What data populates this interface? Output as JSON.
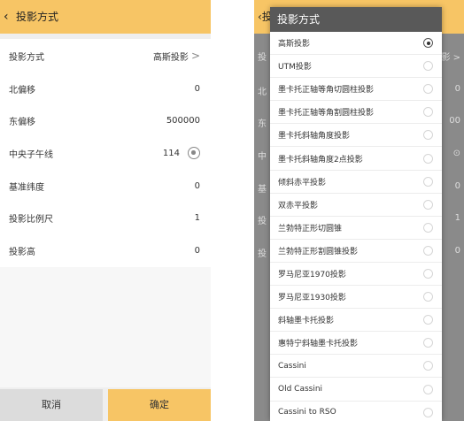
{
  "left": {
    "back_glyph": "‹",
    "title": "投影方式",
    "rows": [
      {
        "label": "投影方式",
        "value": "高斯投影",
        "chevron": ">"
      },
      {
        "label": "北偏移",
        "value": "0"
      },
      {
        "label": "东偏移",
        "value": "500000"
      },
      {
        "label": "中央子午线",
        "value": "114"
      },
      {
        "label": "基准纬度",
        "value": "0"
      },
      {
        "label": "投影比例尺",
        "value": "1"
      },
      {
        "label": "投影高",
        "value": "0"
      }
    ],
    "cancel_label": "取消",
    "ok_label": "确定"
  },
  "right": {
    "bg_header_fragment": "‹投",
    "bg_left_fragments": [
      "投",
      "北",
      "东",
      "中",
      "基",
      "投",
      "投"
    ],
    "bg_right_fragments": [
      "影 >",
      "0",
      "00",
      "⊙",
      "0",
      "1",
      "0"
    ],
    "dialog_title": "投影方式",
    "options": [
      {
        "label": "高斯投影",
        "selected": true
      },
      {
        "label": "UTM投影",
        "selected": false
      },
      {
        "label": "墨卡托正轴等角切圆柱投影",
        "selected": false
      },
      {
        "label": "墨卡托正轴等角割圆柱投影",
        "selected": false
      },
      {
        "label": "墨卡托斜轴角度投影",
        "selected": false
      },
      {
        "label": "墨卡托斜轴角度2点投影",
        "selected": false
      },
      {
        "label": "倾斜赤平投影",
        "selected": false
      },
      {
        "label": "双赤平投影",
        "selected": false
      },
      {
        "label": "兰勃特正形切圆锥",
        "selected": false
      },
      {
        "label": "兰勃特正形割圆锥投影",
        "selected": false
      },
      {
        "label": "罗马尼亚1970投影",
        "selected": false
      },
      {
        "label": "罗马尼亚1930投影",
        "selected": false
      },
      {
        "label": "斜轴墨卡托投影",
        "selected": false
      },
      {
        "label": "惠特宁斜轴墨卡托投影",
        "selected": false
      },
      {
        "label": "Cassini",
        "selected": false
      },
      {
        "label": "Old Cassini",
        "selected": false
      },
      {
        "label": "Cassini to RSO",
        "selected": false
      }
    ]
  },
  "colors": {
    "accent": "#f7c565",
    "dialog_title_bg": "#595959",
    "cancel_bg": "#dcdcdc",
    "page_bg": "#efefef"
  },
  "icons": {
    "back": "chevron-left-icon",
    "more": "chevron-right-icon",
    "locate": "location-target-icon",
    "radio": "radio-button-icon"
  }
}
